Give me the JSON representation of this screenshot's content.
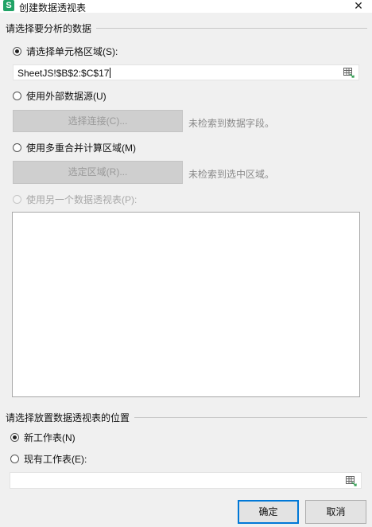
{
  "window": {
    "app_icon_letter": "S",
    "title": "创建数据透视表",
    "close_glyph": "✕"
  },
  "source_section": {
    "header": "请选择要分析的数据",
    "option_range": {
      "label": "请选择单元格区域(S):",
      "selected": true
    },
    "range_input": {
      "value": "SheetJS!$B$2:$C$17"
    },
    "option_external": {
      "label": "使用外部数据源(U)",
      "selected": false
    },
    "choose_connection_button": "选择连接(C)...",
    "external_hint": "未检索到数据字段。",
    "option_multi": {
      "label": "使用多重合并计算区域(M)",
      "selected": false
    },
    "choose_region_button": "选定区域(R)...",
    "multi_hint": "未检索到选中区域。",
    "option_other_pivot": {
      "label": "使用另一个数据透视表(P):",
      "selected": false,
      "disabled": true
    }
  },
  "placement_section": {
    "header": "请选择放置数据透视表的位置",
    "option_new_sheet": {
      "label": "新工作表(N)",
      "selected": true
    },
    "option_existing_sheet": {
      "label": "现有工作表(E):",
      "selected": false
    },
    "existing_input": {
      "value": ""
    }
  },
  "footer": {
    "ok_label": "确定",
    "cancel_label": "取消"
  },
  "colors": {
    "app_icon": "#21a366",
    "primary_border": "#0078d7",
    "range_icon_green": "#2e9e4f"
  },
  "icons": [
    "spreadsheet-app-icon",
    "close-icon",
    "range-select-icon"
  ]
}
